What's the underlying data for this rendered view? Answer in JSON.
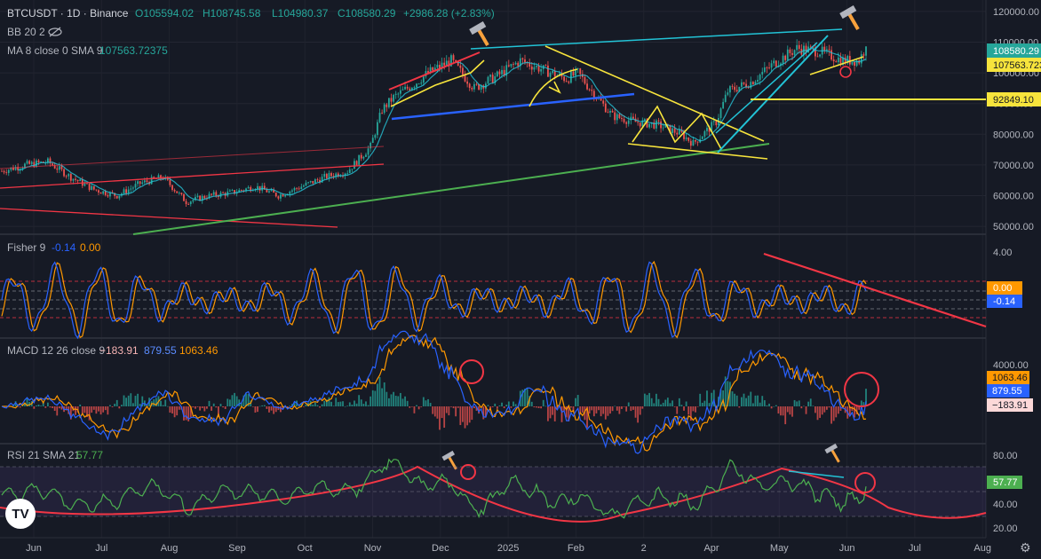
{
  "header": {
    "symbol": "BTCUSDT · 1D · Binance",
    "ohlc": {
      "o": "O105594.02",
      "h": "H108745.58",
      "l": "L104980.37",
      "c": "C108580.29",
      "chg": "+2986.28 (+2.83%)"
    },
    "bb_label": "BB 20 2",
    "ma_label": "MA 8 close 0 SMA 9",
    "ma_value": "107563.72375"
  },
  "price_axis": {
    "ticks": [
      "120000.00",
      "110000.00",
      "100000.00",
      "90000.00",
      "80000.00",
      "70000.00",
      "60000.00",
      "50000.00"
    ],
    "last_price_tag": "108580.29",
    "ma_tag": "107563.723",
    "level_tag": "92849.10"
  },
  "fisher": {
    "label": "Fisher 9",
    "v1": "-0.14",
    "v2": "0.00",
    "ticks": [
      "4.00"
    ],
    "tag_a": "0.00",
    "tag_b": "-0.14"
  },
  "macd": {
    "label": "MACD 12 26 close 9",
    "hist": "−183.91",
    "macd": "879.55",
    "signal": "1063.46",
    "tick": "4000.00",
    "tag_signal": "1063.46",
    "tag_macd": "879.55",
    "tag_hist": "−183.91"
  },
  "rsi": {
    "label": "RSI 21 SMA 21",
    "value": "57.77",
    "ticks": [
      "80.00",
      "40.00",
      "20.00"
    ],
    "tag": "57.77"
  },
  "time_axis": [
    "Jun",
    "Jul",
    "Aug",
    "Sep",
    "Oct",
    "Nov",
    "Dec",
    "2025",
    "Feb",
    "2",
    "Apr",
    "May",
    "Jun",
    "Jul",
    "Aug"
  ],
  "logo": "TV",
  "colors": {
    "up": "#26a69a",
    "down": "#ef5350",
    "yellow": "#f7e43c",
    "blue": "#2962ff",
    "cyan": "#22c3d6",
    "green": "#4caf50",
    "pink": "#f23645",
    "orange": "#ff9800"
  },
  "chart_data": [
    {
      "type": "candlestick",
      "title": "BTCUSDT · 1D · Binance",
      "ylim": [
        48000,
        122000
      ],
      "y_ticks": [
        120000,
        110000,
        100000,
        90000,
        80000,
        70000,
        60000,
        50000
      ],
      "x_labels": [
        "Jun",
        "Jul",
        "Aug",
        "Sep",
        "Oct",
        "Nov",
        "Dec",
        "2025",
        "Feb",
        "2",
        "Apr",
        "May",
        "Jun",
        "Jul",
        "Aug"
      ],
      "series": [
        {
          "name": "Close (approx.)",
          "values": [
            [
              0,
              68000
            ],
            [
              10,
              70000
            ],
            [
              20,
              71000
            ],
            [
              30,
              66000
            ],
            [
              40,
              62000
            ],
            [
              50,
              60000
            ],
            [
              60,
              64000
            ],
            [
              70,
              66000
            ],
            [
              80,
              58000
            ],
            [
              90,
              60000
            ],
            [
              100,
              61000
            ],
            [
              110,
              63000
            ],
            [
              120,
              60000
            ],
            [
              130,
              63000
            ],
            [
              140,
              66000
            ],
            [
              150,
              68000
            ],
            [
              155,
              72000
            ],
            [
              160,
              76000
            ],
            [
              165,
              88000
            ],
            [
              170,
              92000
            ],
            [
              180,
              97000
            ],
            [
              185,
              100000
            ],
            [
              195,
              104000
            ],
            [
              205,
              95000
            ],
            [
              215,
              99000
            ],
            [
              225,
              104000
            ],
            [
              235,
              101000
            ],
            [
              245,
              98000
            ],
            [
              250,
              100000
            ],
            [
              255,
              95000
            ],
            [
              265,
              86000
            ],
            [
              275,
              84000
            ],
            [
              285,
              83000
            ],
            [
              295,
              80000
            ],
            [
              300,
              77000
            ],
            [
              310,
              84000
            ],
            [
              315,
              94000
            ],
            [
              325,
              97000
            ],
            [
              335,
              103000
            ],
            [
              345,
              108000
            ],
            [
              355,
              107000
            ],
            [
              365,
              104000
            ],
            [
              372,
              104000
            ],
            [
              375,
              108580
            ]
          ]
        }
      ],
      "last_price": 108580.29,
      "ma_value": 107563.72375,
      "horizontal_level": 92849.1
    },
    {
      "type": "line",
      "title": "Fisher 9",
      "series": [
        {
          "name": "Fisher",
          "last": -0.14
        },
        {
          "name": "Trigger",
          "last": 0.0
        }
      ],
      "ylim": [
        -5,
        5
      ]
    },
    {
      "type": "line",
      "title": "MACD 12 26 close 9",
      "series": [
        {
          "name": "Histogram",
          "last": -183.91
        },
        {
          "name": "MACD",
          "last": 879.55
        },
        {
          "name": "Signal",
          "last": 1063.46
        }
      ]
    },
    {
      "type": "line",
      "title": "RSI 21 SMA 21",
      "series": [
        {
          "name": "RSI",
          "last": 57.77
        }
      ],
      "ylim": [
        15,
        85
      ]
    }
  ]
}
